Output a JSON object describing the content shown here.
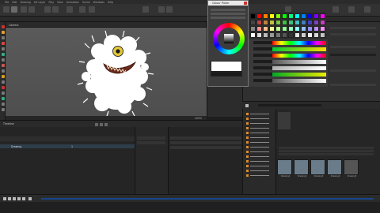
{
  "menu": [
    "File",
    "Edit",
    "Drawing",
    "Art Layer",
    "Play",
    "View",
    "Animation",
    "Scene",
    "Windows",
    "Help"
  ],
  "viewport": {
    "tab_label": "Camera",
    "status_zoom": "100%"
  },
  "color_picker": {
    "title": "Colour Picker"
  },
  "timeline": {
    "tab_label": "Timeline",
    "layer_name": "Drawing",
    "frame": "1"
  },
  "library": {
    "thumbs": [
      "Drawing1",
      "Drawing2",
      "Drawing3",
      "Drawing4",
      "Drawing5"
    ]
  },
  "colors": {
    "accent": "#17468c",
    "folder_icon": "#e08a2a",
    "selected_row": "#2d3d4a"
  }
}
